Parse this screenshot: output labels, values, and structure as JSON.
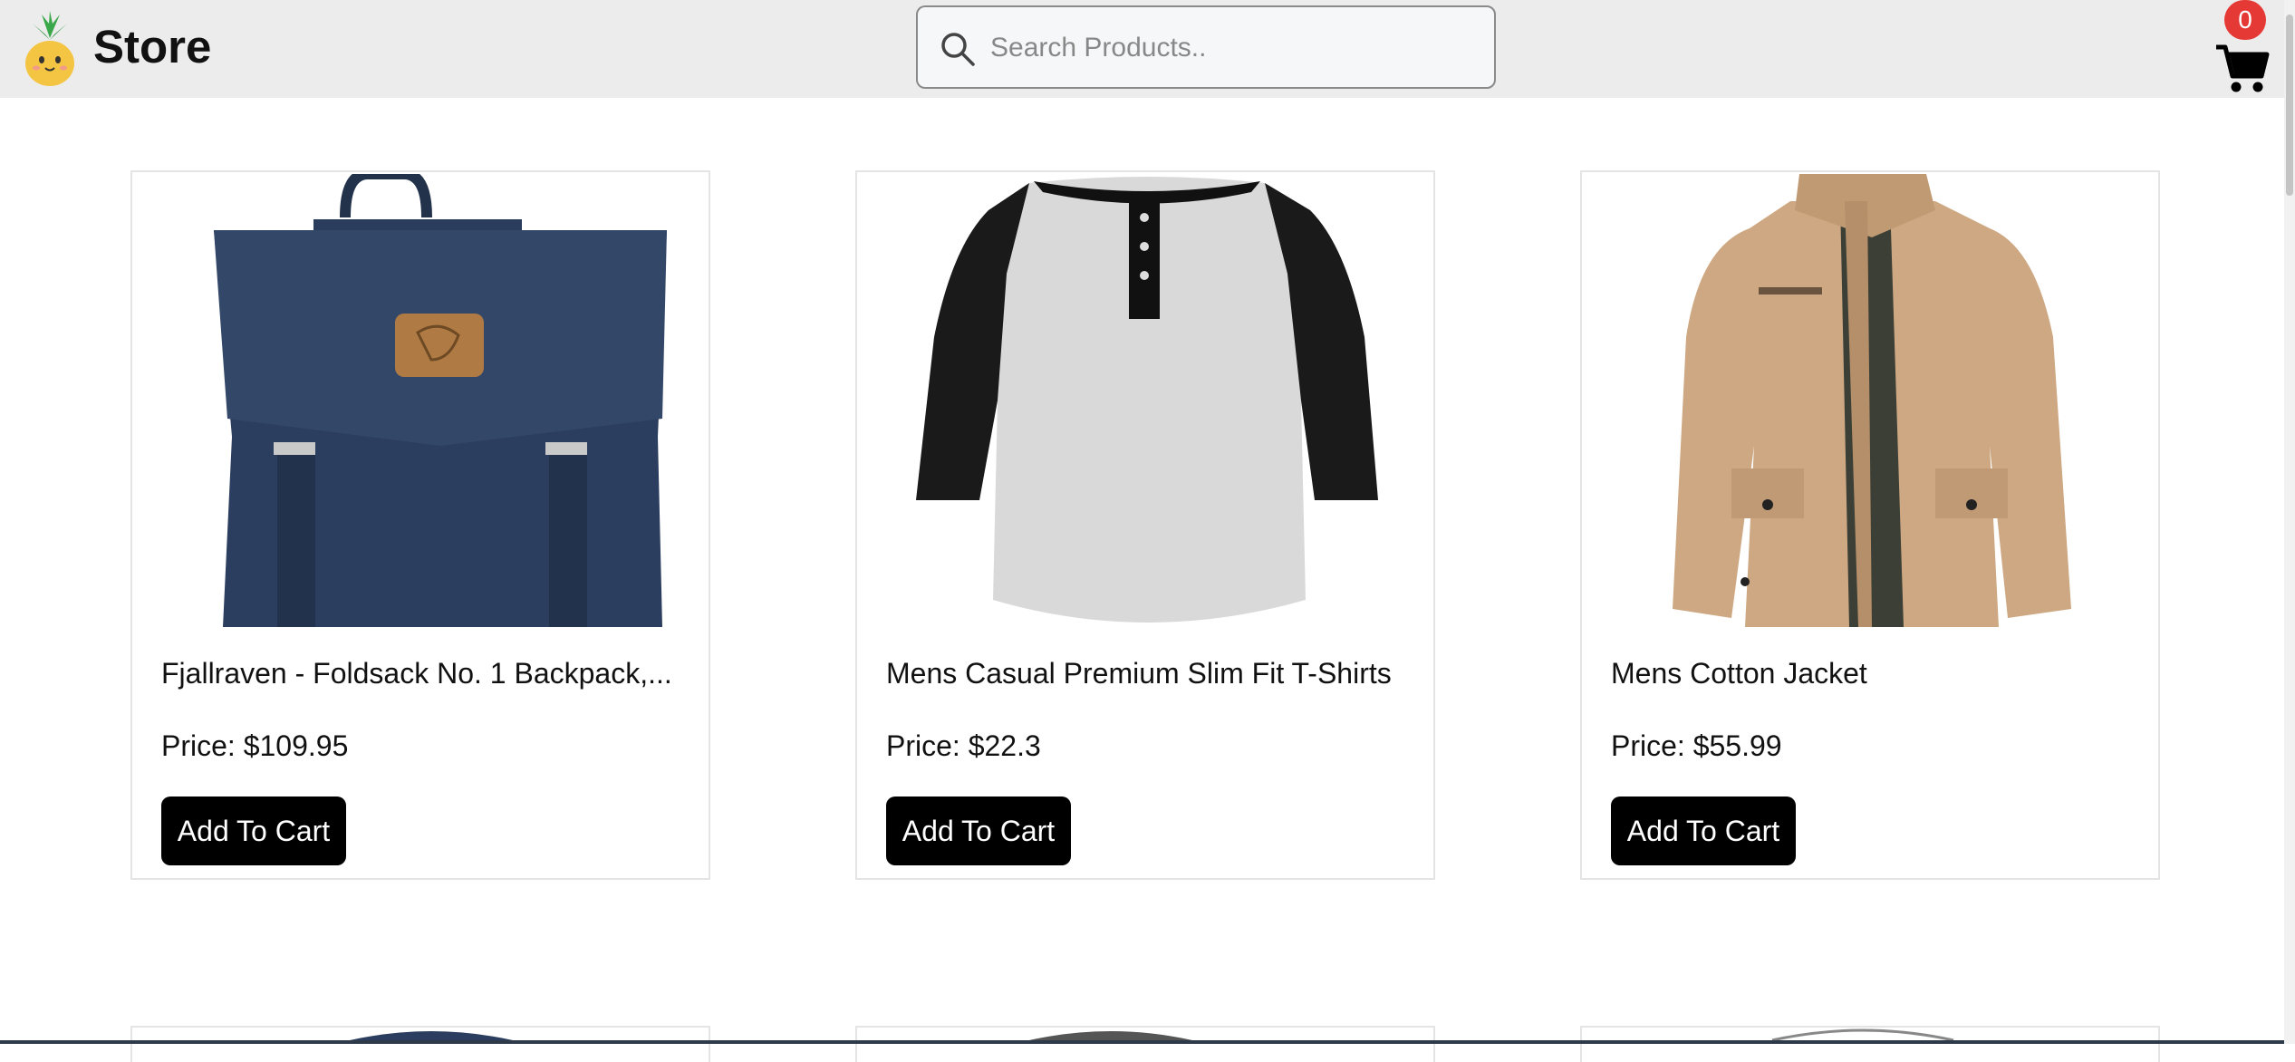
{
  "header": {
    "brand": "Store",
    "logo_icon": "pineapple-icon",
    "search": {
      "placeholder": "Search Products..",
      "value": ""
    },
    "cart": {
      "icon": "cart-icon",
      "count": "0",
      "badge_color": "#e53935"
    }
  },
  "products": [
    {
      "title": "Fjallraven - Foldsack No. 1 Backpack,...",
      "price": "Price: $109.95",
      "button": "Add To Cart"
    },
    {
      "title": "Mens Casual Premium Slim Fit T-Shirts",
      "price": "Price: $22.3",
      "button": "Add To Cart"
    },
    {
      "title": "Mens Cotton Jacket",
      "price": "Price: $55.99",
      "button": "Add To Cart"
    }
  ],
  "colors": {
    "header_bg": "#ececec",
    "button_bg": "#000000",
    "button_text": "#ffffff"
  }
}
